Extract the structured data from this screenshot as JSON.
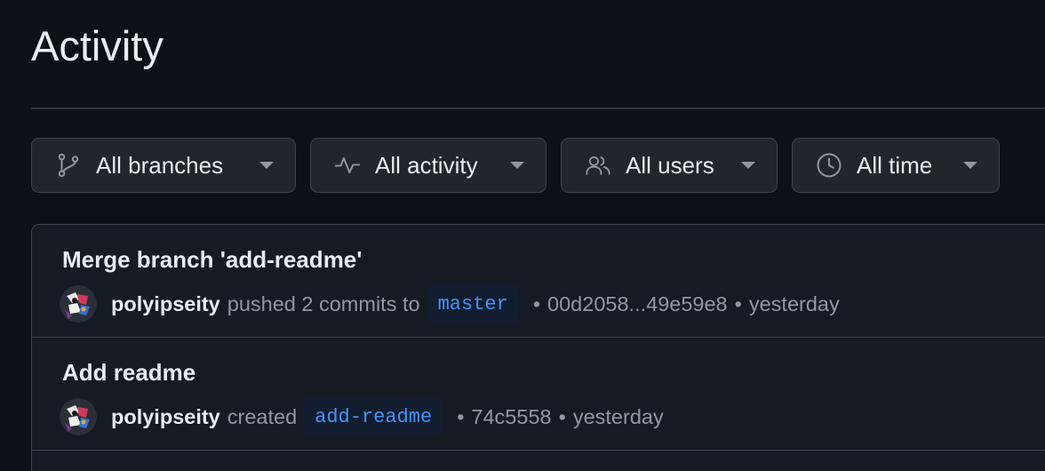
{
  "page_title": "Activity",
  "filters": {
    "branches": {
      "label": "All branches",
      "icon": "git-branch-icon"
    },
    "activity": {
      "label": "All activity",
      "icon": "pulse-icon"
    },
    "users": {
      "label": "All users",
      "icon": "people-icon"
    },
    "time": {
      "label": "All time",
      "icon": "clock-icon"
    }
  },
  "activity_items": [
    {
      "message": "Merge branch 'add-readme'",
      "user": "polyipseity",
      "action": "pushed 2 commits to",
      "ref": "master",
      "sha": "00d2058...49e59e8",
      "separator": "•",
      "time": "yesterday"
    },
    {
      "message": "Add readme",
      "user": "polyipseity",
      "action": "created",
      "ref": "add-readme",
      "sha": "74c5558",
      "separator": "•",
      "time": "yesterday"
    }
  ],
  "colors": {
    "background": "#0d1117",
    "border": "#3d444d",
    "button_bg": "#21262d",
    "ref_text": "#4493f8",
    "ref_bg": "#121d2f",
    "muted_text": "#9198a1"
  }
}
